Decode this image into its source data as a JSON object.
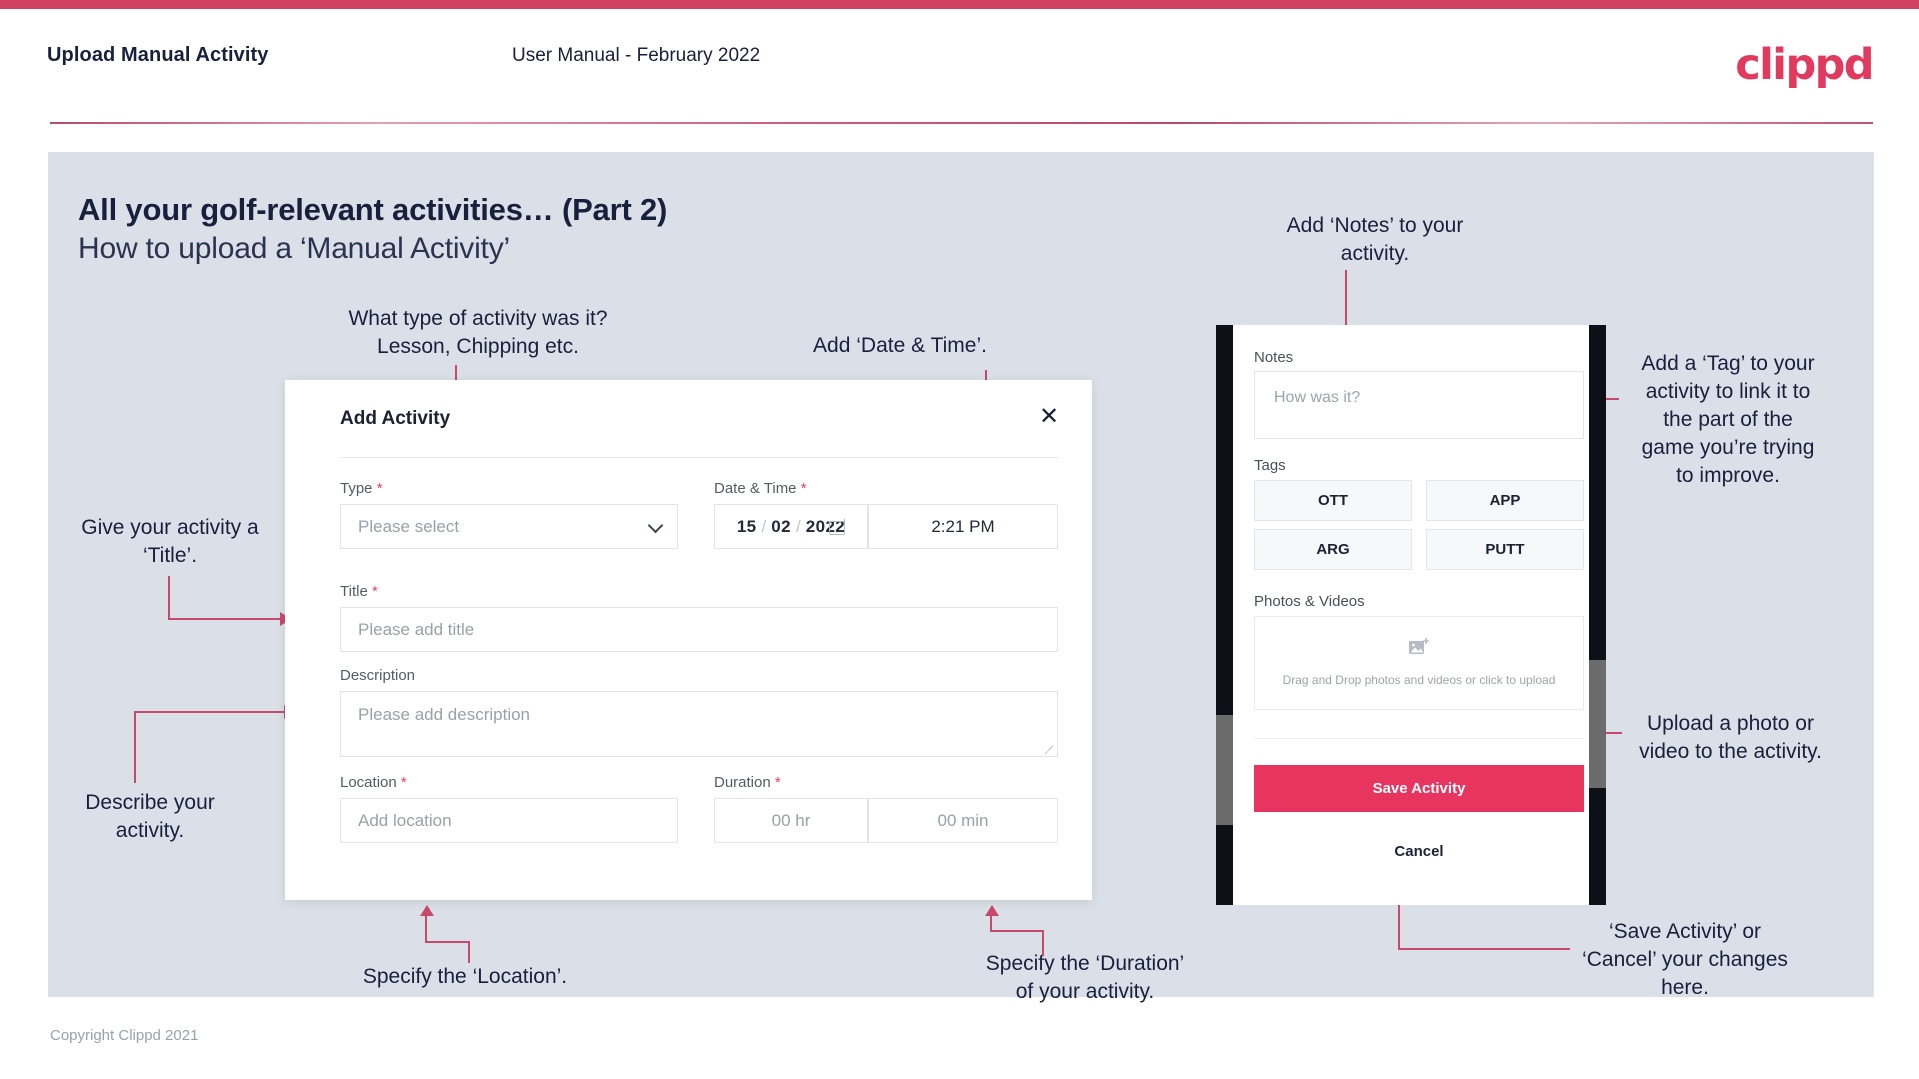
{
  "header": {
    "title": "Upload Manual Activity",
    "subtitle": "User Manual - February 2022",
    "logo": "clippd"
  },
  "slide": {
    "title": "All your golf-relevant activities… (Part 2)",
    "subtitle": "How to upload a ‘Manual Activity’"
  },
  "footer": {
    "copyright": "Copyright Clippd 2021"
  },
  "annotations": {
    "type": "What type of activity was it?\nLesson, Chipping etc.",
    "datetime": "Add ‘Date & Time’.",
    "title": "Give your activity a\n‘Title’.",
    "description": "Describe your\nactivity.",
    "location": "Specify the ‘Location’.",
    "duration": "Specify the ‘Duration’\nof your activity.",
    "notes": "Add ‘Notes’ to your\nactivity.",
    "tags": "Add a ‘Tag’ to your\nactivity to link it to\nthe part of the\ngame you’re trying\nto improve.",
    "photos": "Upload a photo or\nvideo to the activity.",
    "save": "‘Save Activity’ or\n‘Cancel’ your changes\nhere."
  },
  "dialog": {
    "title": "Add Activity",
    "close_icon": "close-icon",
    "fields": {
      "type": {
        "label": "Type",
        "required": "*",
        "placeholder": "Please select"
      },
      "datetime": {
        "label": "Date & Time",
        "required": "*",
        "day": "15",
        "month": "02",
        "year": "2022",
        "sep": "/",
        "time": "2:21 PM"
      },
      "title": {
        "label": "Title",
        "required": "*",
        "placeholder": "Please add title"
      },
      "description": {
        "label": "Description",
        "required": "",
        "placeholder": "Please add description"
      },
      "location": {
        "label": "Location",
        "required": "*",
        "placeholder": "Add location"
      },
      "duration": {
        "label": "Duration",
        "required": "*",
        "hours_placeholder": "00 hr",
        "minutes_placeholder": "00 min"
      }
    }
  },
  "phone": {
    "notes": {
      "label": "Notes",
      "placeholder": "How was it?"
    },
    "tags": {
      "label": "Tags",
      "options": [
        "OTT",
        "APP",
        "ARG",
        "PUTT"
      ]
    },
    "photos": {
      "label": "Photos & Videos",
      "upload_text": "Drag and Drop photos and videos or click to upload",
      "icon": "image-add-icon"
    },
    "save_label": "Save Activity",
    "cancel_label": "Cancel"
  },
  "colors": {
    "brand_red": "#e23a5e",
    "accent_pink": "#e8355f",
    "connector": "#c84a6b",
    "slide_bg": "#dbe0e8",
    "ink": "#17203c"
  }
}
